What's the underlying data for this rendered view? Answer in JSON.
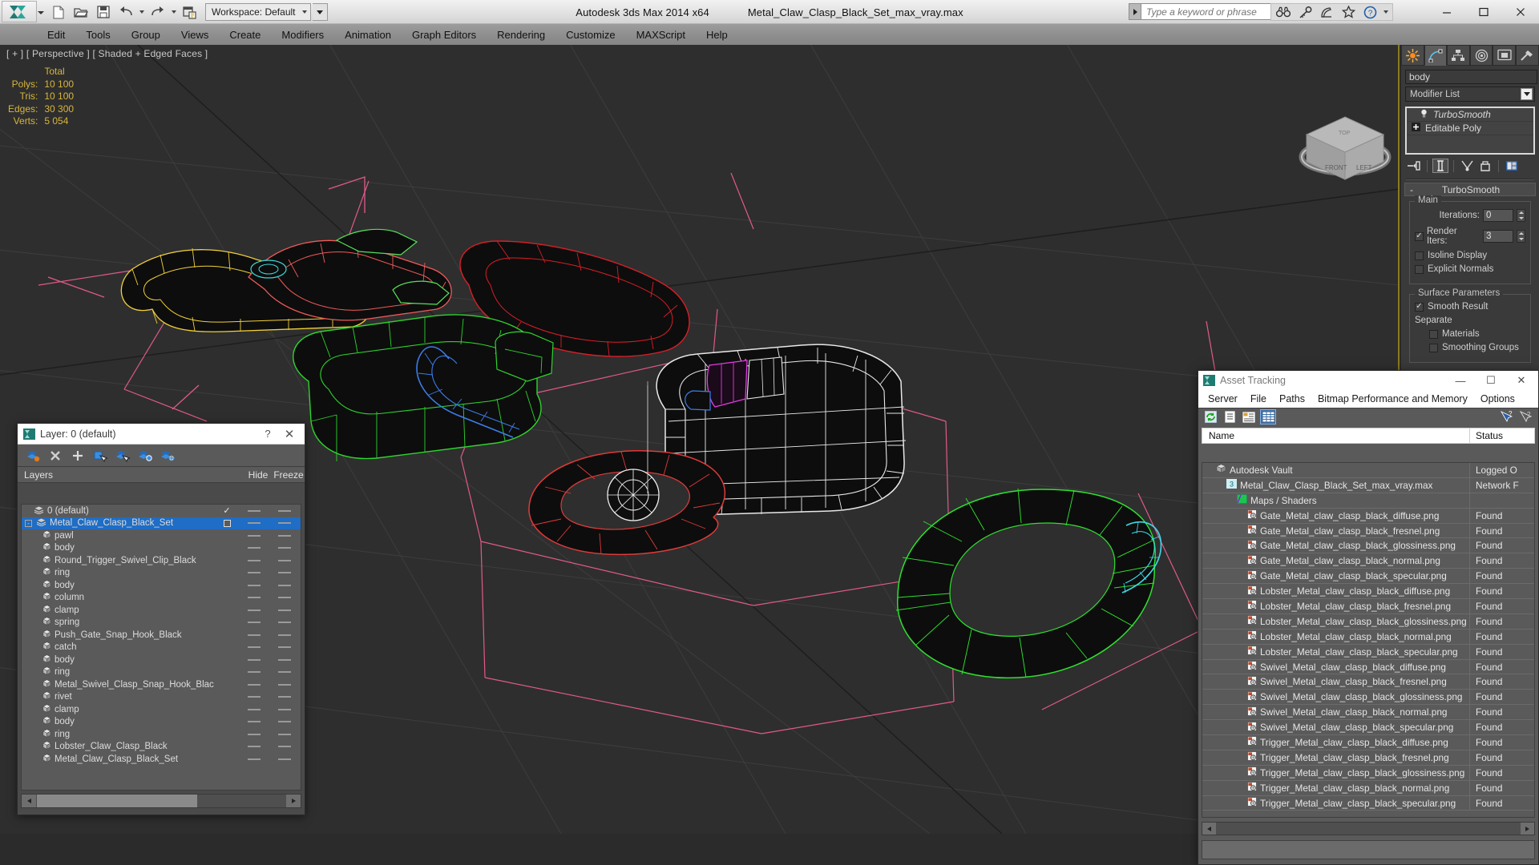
{
  "window": {
    "app_title": "Autodesk 3ds Max  2014 x64",
    "file_title": "Metal_Claw_Clasp_Black_Set_max_vray.max",
    "minimize": "—",
    "maximize": "☐",
    "close": "✕"
  },
  "quick_access": {
    "workspace_label": "Workspace: Default",
    "icons": [
      "new-file-icon",
      "open-file-icon",
      "save-file-icon",
      "undo-icon",
      "redo-icon",
      "project-folder-icon"
    ]
  },
  "search": {
    "placeholder": "Type a keyword or phrase",
    "icons": [
      "binoculars-icon",
      "key-icon",
      "satellite-icon",
      "star-icon",
      "help-icon"
    ]
  },
  "menu": {
    "items": [
      "Edit",
      "Tools",
      "Group",
      "Views",
      "Create",
      "Modifiers",
      "Animation",
      "Graph Editors",
      "Rendering",
      "Customize",
      "MAXScript",
      "Help"
    ]
  },
  "viewport": {
    "label": "[ + ] [ Perspective ] [ Shaded + Edged Faces ]",
    "stats_header": "Total",
    "stats": [
      {
        "label": "Polys:",
        "value": "10 100"
      },
      {
        "label": "Tris:",
        "value": "10 100"
      },
      {
        "label": "Edges:",
        "value": "30 300"
      },
      {
        "label": "Verts:",
        "value": "5 054"
      }
    ],
    "grid_color": "#3a3a3a",
    "helper_color": "#e05a8a"
  },
  "command_panel": {
    "tabs": [
      "create-tab",
      "modify-tab",
      "hierarchy-tab",
      "motion-tab",
      "display-tab",
      "utilities-tab"
    ],
    "active_tab_index": 1,
    "object_name": "body",
    "object_color": "#1bc81b",
    "modifier_list_label": "Modifier List",
    "stack": [
      {
        "label": "TurboSmooth",
        "italic": true,
        "icon": "lightbulb-icon"
      },
      {
        "label": "Editable Poly",
        "italic": false,
        "icon": "plus-box-icon"
      }
    ],
    "stack_tools": [
      "pin-stack-icon",
      "show-end-result-icon",
      "make-unique-icon",
      "remove-modifier-icon",
      "configure-sets-icon"
    ],
    "rollout": {
      "title": "TurboSmooth",
      "collapse": "-",
      "groups": [
        {
          "title": "Main",
          "fields": [
            {
              "type": "spin",
              "label": "Iterations:",
              "value": "0"
            },
            {
              "type": "spin_check",
              "label": "Render Iters:",
              "value": "3",
              "checked": true
            },
            {
              "type": "check",
              "label": "Isoline Display",
              "checked": false
            },
            {
              "type": "check",
              "label": "Explicit Normals",
              "checked": false
            }
          ]
        },
        {
          "title": "Surface Parameters",
          "fields": [
            {
              "type": "check",
              "label": "Smooth Result",
              "checked": true
            },
            {
              "type": "text",
              "label": "Separate"
            },
            {
              "type": "check_indent",
              "label": "Materials",
              "checked": false
            },
            {
              "type": "check_indent",
              "label": "Smoothing Groups",
              "checked": false
            }
          ]
        }
      ]
    }
  },
  "layer_dialog": {
    "title": "Layer: 0 (default)",
    "help": "?",
    "close": "✕",
    "toolbar": [
      "new-layer-icon",
      "delete-layer-icon",
      "add-layer-icon",
      "select-objects-in-layer-icon",
      "select-highlighted-layer-icon",
      "highlight-selected-objects-layer-icon",
      "layer-properties-icon"
    ],
    "columns": {
      "name": "Layers",
      "hide": "Hide",
      "freeze": "Freeze"
    },
    "rows": [
      {
        "name": "0 (default)",
        "indent": 1,
        "type": "layer",
        "current": true,
        "check": true,
        "selected": false,
        "expander": null
      },
      {
        "name": "Metal_Claw_Clasp_Black_Set",
        "indent": 0,
        "type": "layer",
        "current": false,
        "check": false,
        "box": true,
        "selected": true,
        "expander": "-"
      },
      {
        "name": "pawl",
        "indent": 2,
        "type": "object"
      },
      {
        "name": "body",
        "indent": 2,
        "type": "object"
      },
      {
        "name": "Round_Trigger_Swivel_Clip_Black",
        "indent": 2,
        "type": "object"
      },
      {
        "name": "ring",
        "indent": 2,
        "type": "object"
      },
      {
        "name": "body",
        "indent": 2,
        "type": "object"
      },
      {
        "name": "column",
        "indent": 2,
        "type": "object"
      },
      {
        "name": "clamp",
        "indent": 2,
        "type": "object"
      },
      {
        "name": "spring",
        "indent": 2,
        "type": "object"
      },
      {
        "name": "Push_Gate_Snap_Hook_Black",
        "indent": 2,
        "type": "object"
      },
      {
        "name": "catch",
        "indent": 2,
        "type": "object"
      },
      {
        "name": "body",
        "indent": 2,
        "type": "object"
      },
      {
        "name": "ring",
        "indent": 2,
        "type": "object"
      },
      {
        "name": "Metal_Swivel_Clasp_Snap_Hook_Black",
        "indent": 2,
        "type": "object"
      },
      {
        "name": "rivet",
        "indent": 2,
        "type": "object"
      },
      {
        "name": "clamp",
        "indent": 2,
        "type": "object"
      },
      {
        "name": "body",
        "indent": 2,
        "type": "object"
      },
      {
        "name": "ring",
        "indent": 2,
        "type": "object"
      },
      {
        "name": "Lobster_Claw_Clasp_Black",
        "indent": 2,
        "type": "object"
      },
      {
        "name": "Metal_Claw_Clasp_Black_Set",
        "indent": 2,
        "type": "object"
      }
    ]
  },
  "asset_dialog": {
    "title": "Asset Tracking",
    "minimize": "—",
    "maximize": "☐",
    "close": "✕",
    "menu": [
      "Server",
      "File",
      "Paths",
      "Bitmap Performance and Memory",
      "Options"
    ],
    "toolbar": [
      "refresh-icon",
      "list-view-icon",
      "detail-view-icon",
      "grid-view-icon"
    ],
    "toolbar_right": [
      "help-cursor-icon",
      "context-help-icon"
    ],
    "columns": {
      "name": "Name",
      "status": "Status"
    },
    "rows": [
      {
        "name": "Autodesk Vault",
        "status": "Logged O",
        "indent": 1,
        "icon": "vault-icon"
      },
      {
        "name": "Metal_Claw_Clasp_Black_Set_max_vray.max",
        "status": "Network F",
        "indent": 2,
        "icon": "max-file-icon"
      },
      {
        "name": "Maps / Shaders",
        "status": "",
        "indent": 3,
        "icon": "maps-shaders-icon"
      },
      {
        "name": "Gate_Metal_claw_clasp_black_diffuse.png",
        "status": "Found",
        "indent": 4,
        "icon": "png-icon"
      },
      {
        "name": "Gate_Metal_claw_clasp_black_fresnel.png",
        "status": "Found",
        "indent": 4,
        "icon": "png-icon"
      },
      {
        "name": "Gate_Metal_claw_clasp_black_glossiness.png",
        "status": "Found",
        "indent": 4,
        "icon": "png-icon"
      },
      {
        "name": "Gate_Metal_claw_clasp_black_normal.png",
        "status": "Found",
        "indent": 4,
        "icon": "png-icon"
      },
      {
        "name": "Gate_Metal_claw_clasp_black_specular.png",
        "status": "Found",
        "indent": 4,
        "icon": "png-icon"
      },
      {
        "name": "Lobster_Metal_claw_clasp_black_diffuse.png",
        "status": "Found",
        "indent": 4,
        "icon": "png-icon"
      },
      {
        "name": "Lobster_Metal_claw_clasp_black_fresnel.png",
        "status": "Found",
        "indent": 4,
        "icon": "png-icon"
      },
      {
        "name": "Lobster_Metal_claw_clasp_black_glossiness.png",
        "status": "Found",
        "indent": 4,
        "icon": "png-icon"
      },
      {
        "name": "Lobster_Metal_claw_clasp_black_normal.png",
        "status": "Found",
        "indent": 4,
        "icon": "png-icon"
      },
      {
        "name": "Lobster_Metal_claw_clasp_black_specular.png",
        "status": "Found",
        "indent": 4,
        "icon": "png-icon"
      },
      {
        "name": "Swivel_Metal_claw_clasp_black_diffuse.png",
        "status": "Found",
        "indent": 4,
        "icon": "png-icon"
      },
      {
        "name": "Swivel_Metal_claw_clasp_black_fresnel.png",
        "status": "Found",
        "indent": 4,
        "icon": "png-icon"
      },
      {
        "name": "Swivel_Metal_claw_clasp_black_glossiness.png",
        "status": "Found",
        "indent": 4,
        "icon": "png-icon"
      },
      {
        "name": "Swivel_Metal_claw_clasp_black_normal.png",
        "status": "Found",
        "indent": 4,
        "icon": "png-icon"
      },
      {
        "name": "Swivel_Metal_claw_clasp_black_specular.png",
        "status": "Found",
        "indent": 4,
        "icon": "png-icon"
      },
      {
        "name": "Trigger_Metal_claw_clasp_black_diffuse.png",
        "status": "Found",
        "indent": 4,
        "icon": "png-icon"
      },
      {
        "name": "Trigger_Metal_claw_clasp_black_fresnel.png",
        "status": "Found",
        "indent": 4,
        "icon": "png-icon"
      },
      {
        "name": "Trigger_Metal_claw_clasp_black_glossiness.png",
        "status": "Found",
        "indent": 4,
        "icon": "png-icon"
      },
      {
        "name": "Trigger_Metal_claw_clasp_black_normal.png",
        "status": "Found",
        "indent": 4,
        "icon": "png-icon"
      },
      {
        "name": "Trigger_Metal_claw_clasp_black_specular.png",
        "status": "Found",
        "indent": 4,
        "icon": "png-icon"
      }
    ]
  }
}
